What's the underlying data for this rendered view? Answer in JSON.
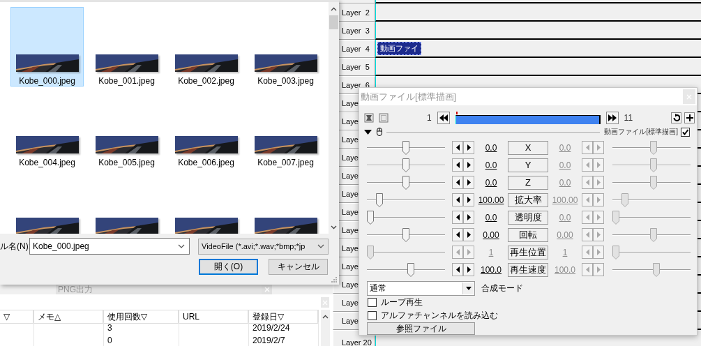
{
  "background_window": {
    "tab": "PNG出力",
    "table": {
      "columns": [
        "▽",
        "メモ△",
        "使用回数▽",
        "URL",
        "登録日▽"
      ],
      "rows": [
        {
          "uses": "3",
          "registered": "2019/2/24"
        },
        {
          "uses": "0",
          "registered": "2019/2/7"
        }
      ]
    }
  },
  "timeline": {
    "layers": [
      {
        "label": "Layer  2"
      },
      {
        "label": "Layer  3"
      },
      {
        "label": "Layer  4",
        "clip": "動画ファイ"
      },
      {
        "label": "Layer  5"
      },
      {
        "label": "Layer  6"
      },
      {
        "label": "Laye"
      },
      {
        "label": "Laye"
      },
      {
        "label": "Laye"
      },
      {
        "label": "Laye"
      },
      {
        "label": "Laye"
      },
      {
        "label": "Laye"
      },
      {
        "label": "Laye"
      },
      {
        "label": "Laye"
      },
      {
        "label": "Laye"
      },
      {
        "label": "Laye"
      },
      {
        "label": "Laye"
      },
      {
        "label": "Laye"
      },
      {
        "label": "Laye"
      },
      {
        "label": "Layer 20"
      }
    ]
  },
  "file_dialog": {
    "files": [
      {
        "name": "Kobe_000.jpeg",
        "selected": true
      },
      {
        "name": "Kobe_001.jpeg",
        "selected": false
      },
      {
        "name": "Kobe_002.jpeg",
        "selected": false
      },
      {
        "name": "Kobe_003.jpeg",
        "selected": false
      },
      {
        "name": "Kobe_004.jpeg",
        "selected": false
      },
      {
        "name": "Kobe_005.jpeg",
        "selected": false
      },
      {
        "name": "Kobe_006.jpeg",
        "selected": false
      },
      {
        "name": "Kobe_007.jpeg",
        "selected": false
      },
      {
        "kind": "picture"
      },
      {
        "kind": "picture"
      },
      {
        "kind": "picture"
      },
      {
        "kind": "picture"
      }
    ],
    "filename_label": "ル名(N):",
    "filename_value": "Kobe_000.jpeg",
    "file_type": "VideoFile (*.avi;*.wav;*bmp;*jp",
    "buttons": [
      {
        "label": "開く(O)",
        "default": true
      },
      {
        "label": "キャンセル",
        "default": false
      }
    ]
  },
  "properties": {
    "title": "動画ファイル[標準描画]",
    "start_frame": "1",
    "end_frame": "11",
    "object_name": "動画ファイル[標準描画]",
    "object_enabled": true,
    "params": [
      {
        "name": "X",
        "start": {
          "value": "0.0",
          "level": 0.5,
          "disabled": false
        },
        "end": {
          "value": "0.0",
          "level": 0.53,
          "disabled": true
        }
      },
      {
        "name": "Y",
        "start": {
          "value": "0.0",
          "level": 0.5,
          "disabled": false
        },
        "end": {
          "value": "0.0",
          "level": 0.53,
          "disabled": true
        }
      },
      {
        "name": "Z",
        "start": {
          "value": "0.0",
          "level": 0.5,
          "disabled": false
        },
        "end": {
          "value": "0.0",
          "level": 0.53,
          "disabled": true
        }
      },
      {
        "name": "拡大率",
        "start": {
          "value": "100.00",
          "level": 0.13,
          "disabled": false
        },
        "end": {
          "value": "100.00",
          "level": 0.13,
          "disabled": true
        }
      },
      {
        "name": "透明度",
        "start": {
          "value": "0.0",
          "level": 0,
          "disabled": false
        },
        "end": {
          "value": "0.0",
          "level": 0,
          "disabled": true
        }
      },
      {
        "name": "回転",
        "start": {
          "value": "0.00",
          "level": 0.5,
          "disabled": false
        },
        "end": {
          "value": "0.00",
          "level": 0.53,
          "disabled": true
        }
      },
      {
        "name": "再生位置",
        "start": {
          "value": "1",
          "level": 0,
          "disabled": true
        },
        "end": {
          "value": "1",
          "level": 0,
          "disabled": true
        }
      },
      {
        "name": "再生速度",
        "start": {
          "value": "100.0",
          "level": 0.57,
          "disabled": false
        },
        "end": {
          "value": "100.0",
          "level": 0.57,
          "disabled": true
        }
      }
    ],
    "blend_mode": "通常",
    "blend_label": "合成モード",
    "options": [
      {
        "label": "ループ再生",
        "checked": false
      },
      {
        "label": "アルファチャンネルを読み込む",
        "checked": false
      }
    ],
    "reference_button": "参照ファイル"
  }
}
